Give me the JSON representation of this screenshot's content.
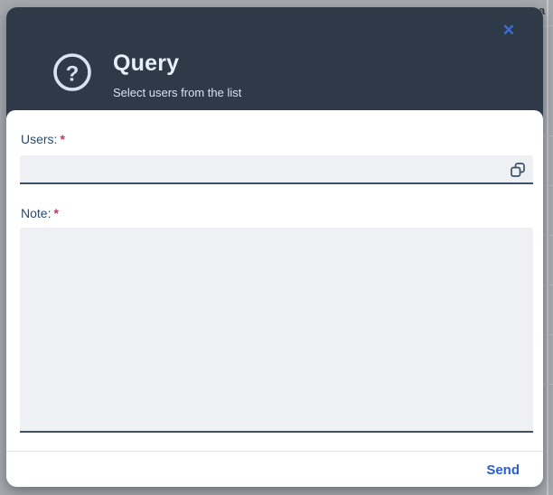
{
  "background_page": {
    "partial_text": "a"
  },
  "modal": {
    "header": {
      "title": "Query",
      "subtitle": "Select users from the list",
      "close_icon": "✕"
    },
    "form": {
      "users_label": "Users:",
      "users_required_marker": "*",
      "users_value": "",
      "note_label": "Note:",
      "note_required_marker": "*",
      "note_value": ""
    },
    "footer": {
      "send_label": "Send"
    }
  },
  "colors": {
    "header_bg": "#2e3a48",
    "backdrop": "#a6a9ae",
    "accent_blue": "#2a5cd7",
    "close_blue": "#3a6ed8",
    "label_navy": "#2a4a70",
    "required_magenta": "#c92f68",
    "field_bg": "#eef0f3",
    "field_border": "#3e506a",
    "icon_light": "#d9e3f2"
  }
}
